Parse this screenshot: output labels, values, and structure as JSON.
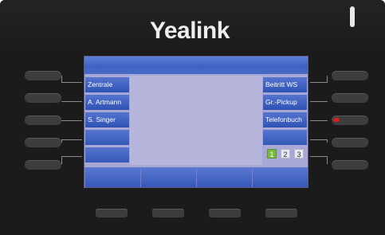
{
  "brand": "Yealink",
  "screen": {
    "title": "",
    "left_keys": [
      "Zentrale",
      "A. Artmann",
      "S. Singer",
      "",
      ""
    ],
    "right_keys": [
      "Beitritt WS",
      "Gr.-Pickup",
      "Telefonbuch",
      "",
      ""
    ],
    "pages": [
      "1",
      "2",
      "3"
    ],
    "active_page": "1",
    "softkeys": [
      "",
      "",
      "",
      ""
    ]
  },
  "colors": {
    "screen_bg": "#a8a8d6",
    "key_blue": "#3f61c1",
    "page_active": "#7ab841",
    "led_red": "#d32222"
  }
}
